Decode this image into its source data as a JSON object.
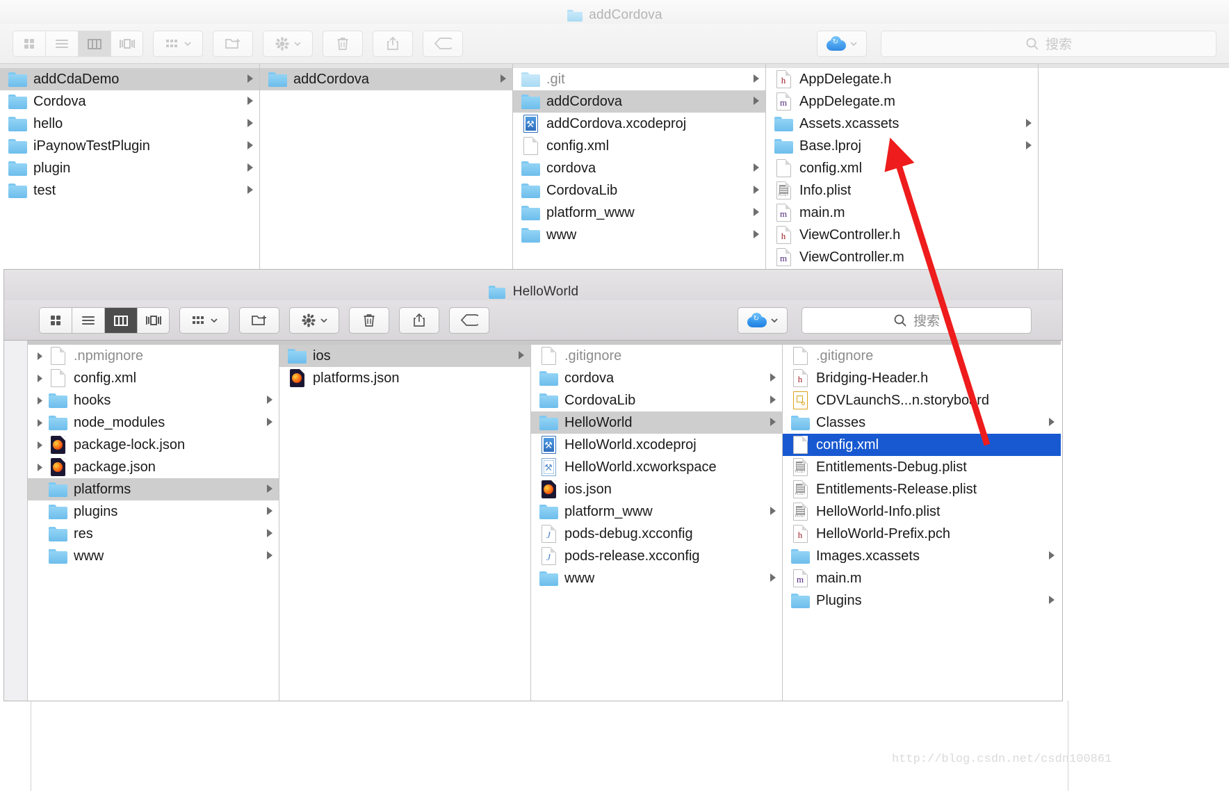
{
  "desktop": {
    "watermark": "http://blog.csdn.net/csdn100861"
  },
  "window1": {
    "title": "addCordova",
    "toolbar": {
      "view_icon_grid": "grid-view-icon",
      "view_icon_list": "list-view-icon",
      "view_icon_column": "column-view-icon",
      "view_icon_gallery": "gallery-view-icon",
      "arrange_label": "arrange-icon",
      "new_folder_label": "new-folder-icon",
      "action_label": "gear-icon",
      "delete_label": "trash-icon",
      "share_label": "share-icon",
      "tag_label": "tag-icon",
      "icloud_label": "icloud-icon",
      "search_placeholder": "搜索"
    },
    "columns": [
      {
        "name": "column-1",
        "items": [
          {
            "label": "addCdaDemo",
            "icon": "folder",
            "chevron": true,
            "state": "selected-gray"
          },
          {
            "label": "Cordova",
            "icon": "folder",
            "chevron": true,
            "state": "normal"
          },
          {
            "label": "hello",
            "icon": "folder",
            "chevron": true,
            "state": "normal"
          },
          {
            "label": "iPaynowTestPlugin",
            "icon": "folder",
            "chevron": true,
            "state": "normal"
          },
          {
            "label": "plugin",
            "icon": "folder",
            "chevron": true,
            "state": "normal"
          },
          {
            "label": "test",
            "icon": "folder",
            "chevron": true,
            "state": "normal"
          }
        ]
      },
      {
        "name": "column-2",
        "items": [
          {
            "label": "addCordova",
            "icon": "folder",
            "chevron": true,
            "state": "selected-gray"
          }
        ]
      },
      {
        "name": "column-3",
        "items": [
          {
            "label": ".git",
            "icon": "folder-pale",
            "chevron": true,
            "state": "dim"
          },
          {
            "label": "addCordova",
            "icon": "folder",
            "chevron": true,
            "state": "selected-gray"
          },
          {
            "label": "addCordova.xcodeproj",
            "icon": "xcodeproj",
            "chevron": false,
            "state": "normal"
          },
          {
            "label": "config.xml",
            "icon": "doc",
            "chevron": false,
            "state": "normal"
          },
          {
            "label": "cordova",
            "icon": "folder",
            "chevron": true,
            "state": "normal"
          },
          {
            "label": "CordovaLib",
            "icon": "folder",
            "chevron": true,
            "state": "normal"
          },
          {
            "label": "platform_www",
            "icon": "folder",
            "chevron": true,
            "state": "normal"
          },
          {
            "label": "www",
            "icon": "folder",
            "chevron": true,
            "state": "normal"
          }
        ]
      },
      {
        "name": "column-4",
        "items": [
          {
            "label": "AppDelegate.h",
            "icon": "doc-h",
            "chevron": false,
            "state": "normal"
          },
          {
            "label": "AppDelegate.m",
            "icon": "doc-m",
            "chevron": false,
            "state": "normal"
          },
          {
            "label": "Assets.xcassets",
            "icon": "folder",
            "chevron": true,
            "state": "normal"
          },
          {
            "label": "Base.lproj",
            "icon": "folder",
            "chevron": true,
            "state": "normal"
          },
          {
            "label": "config.xml",
            "icon": "doc",
            "chevron": false,
            "state": "normal"
          },
          {
            "label": "Info.plist",
            "icon": "doc-plist",
            "chevron": false,
            "state": "normal"
          },
          {
            "label": "main.m",
            "icon": "doc-m",
            "chevron": false,
            "state": "normal"
          },
          {
            "label": "ViewController.h",
            "icon": "doc-h",
            "chevron": false,
            "state": "normal"
          },
          {
            "label": "ViewController.m",
            "icon": "doc-m",
            "chevron": false,
            "state": "normal"
          }
        ]
      }
    ]
  },
  "window2": {
    "title": "HelloWorld",
    "toolbar": {
      "view_icon_grid": "grid-view-icon",
      "view_icon_list": "list-view-icon",
      "view_icon_column": "column-view-icon",
      "view_icon_gallery": "gallery-view-icon",
      "arrange_label": "arrange-icon",
      "new_folder_label": "new-folder-icon",
      "action_label": "gear-icon",
      "delete_label": "trash-icon",
      "share_label": "share-icon",
      "tag_label": "tag-icon",
      "icloud_label": "icloud-icon",
      "search_placeholder": "搜索"
    },
    "columns": [
      {
        "name": "column-1",
        "items": [
          {
            "label": ".npmignore",
            "icon": "doc",
            "chevron": false,
            "state": "dim",
            "left_disclosure": true
          },
          {
            "label": "config.xml",
            "icon": "doc",
            "chevron": false,
            "state": "normal",
            "left_disclosure": true
          },
          {
            "label": "hooks",
            "icon": "folder",
            "chevron": true,
            "state": "normal",
            "left_disclosure": true
          },
          {
            "label": "node_modules",
            "icon": "folder",
            "chevron": true,
            "state": "normal",
            "left_disclosure": true
          },
          {
            "label": "package-lock.json",
            "icon": "json",
            "chevron": false,
            "state": "normal",
            "left_disclosure": true
          },
          {
            "label": "package.json",
            "icon": "json",
            "chevron": false,
            "state": "normal",
            "left_disclosure": true
          },
          {
            "label": "platforms",
            "icon": "folder",
            "chevron": true,
            "state": "selected-gray",
            "left_disclosure": false
          },
          {
            "label": "plugins",
            "icon": "folder",
            "chevron": true,
            "state": "normal",
            "left_disclosure": false
          },
          {
            "label": "res",
            "icon": "folder",
            "chevron": true,
            "state": "normal",
            "left_disclosure": false
          },
          {
            "label": "www",
            "icon": "folder",
            "chevron": true,
            "state": "normal",
            "left_disclosure": false
          }
        ]
      },
      {
        "name": "column-2",
        "items": [
          {
            "label": "ios",
            "icon": "folder",
            "chevron": true,
            "state": "selected-gray"
          },
          {
            "label": "platforms.json",
            "icon": "json",
            "chevron": false,
            "state": "normal"
          }
        ]
      },
      {
        "name": "column-3",
        "items": [
          {
            "label": ".gitignore",
            "icon": "doc",
            "chevron": false,
            "state": "dim"
          },
          {
            "label": "cordova",
            "icon": "folder",
            "chevron": true,
            "state": "normal"
          },
          {
            "label": "CordovaLib",
            "icon": "folder",
            "chevron": true,
            "state": "normal"
          },
          {
            "label": "HelloWorld",
            "icon": "folder",
            "chevron": true,
            "state": "selected-gray"
          },
          {
            "label": "HelloWorld.xcodeproj",
            "icon": "xcodeproj",
            "chevron": false,
            "state": "normal"
          },
          {
            "label": "HelloWorld.xcworkspace",
            "icon": "xcworkspace",
            "chevron": false,
            "state": "normal"
          },
          {
            "label": "ios.json",
            "icon": "json",
            "chevron": false,
            "state": "normal"
          },
          {
            "label": "platform_www",
            "icon": "folder",
            "chevron": true,
            "state": "normal"
          },
          {
            "label": "pods-debug.xcconfig",
            "icon": "doc-j",
            "chevron": false,
            "state": "normal"
          },
          {
            "label": "pods-release.xcconfig",
            "icon": "doc-j",
            "chevron": false,
            "state": "normal"
          },
          {
            "label": "www",
            "icon": "folder",
            "chevron": true,
            "state": "normal"
          }
        ]
      },
      {
        "name": "column-4",
        "items": [
          {
            "label": ".gitignore",
            "icon": "doc",
            "chevron": false,
            "state": "dim"
          },
          {
            "label": "Bridging-Header.h",
            "icon": "doc-h",
            "chevron": false,
            "state": "normal"
          },
          {
            "label": "CDVLaunchS...n.storyboard",
            "icon": "storyboard",
            "chevron": false,
            "state": "normal"
          },
          {
            "label": "Classes",
            "icon": "folder",
            "chevron": true,
            "state": "normal"
          },
          {
            "label": "config.xml",
            "icon": "doc",
            "chevron": false,
            "state": "selected-blue"
          },
          {
            "label": "Entitlements-Debug.plist",
            "icon": "doc-plist",
            "chevron": false,
            "state": "normal"
          },
          {
            "label": "Entitlements-Release.plist",
            "icon": "doc-plist",
            "chevron": false,
            "state": "normal"
          },
          {
            "label": "HelloWorld-Info.plist",
            "icon": "doc-plist",
            "chevron": false,
            "state": "normal"
          },
          {
            "label": "HelloWorld-Prefix.pch",
            "icon": "doc-h",
            "chevron": false,
            "state": "normal"
          },
          {
            "label": "Images.xcassets",
            "icon": "folder",
            "chevron": true,
            "state": "normal"
          },
          {
            "label": "main.m",
            "icon": "doc-m",
            "chevron": false,
            "state": "normal"
          },
          {
            "label": "Plugins",
            "icon": "folder",
            "chevron": true,
            "state": "normal"
          }
        ]
      }
    ]
  },
  "annotation": {
    "arrow_color": "#ee1c1c",
    "description": "red-arrow-pointing-to-config-xml"
  }
}
